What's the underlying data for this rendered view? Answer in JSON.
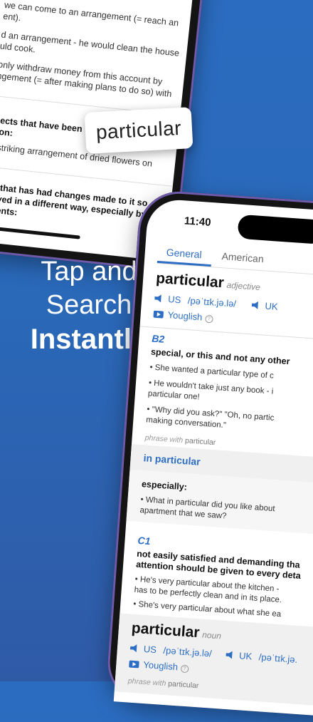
{
  "top_phone": {
    "lines": [
      "we can come to an arrangement (= reach an",
      "ent).",
      "d an arrangement - he would clean the house",
      "uld cook.",
      "only withdraw money from this account by",
      "ngement (= after making plans to do so) with",
      "bjects that have been",
      "ition:",
      "a striking arrangement of dried flowers on",
      "sic that has had changes made to it so",
      "played in a different way, especially by",
      "uments:"
    ]
  },
  "popup_word": "particular",
  "headline": {
    "line1": "Tap and",
    "line2": "Search",
    "line3": "Instantly"
  },
  "dictionary": {
    "time": "11:40",
    "tabs": [
      "General",
      "American"
    ],
    "entry1": {
      "headword": "particular",
      "pos": "adjective",
      "us_label": "US",
      "us_ipa": "/pəˈtɪk.jə.lə/",
      "uk_label": "UK",
      "youglish": "Youglish",
      "help": "?"
    },
    "sense1": {
      "level": "B2",
      "definition": "special, or this and not any other",
      "examples": [
        "• She wanted a particular type of c",
        "• He wouldn't take just any book - i",
        "particular one!",
        "• \"Why did you ask?\" \"Oh, no partic",
        "making conversation.\""
      ]
    },
    "phrase1": {
      "prefix": "phrase with",
      "word": "particular",
      "head": "in particular",
      "definition": "especially:",
      "examples": [
        "• What in particular did you like about",
        "apartment that we saw?"
      ]
    },
    "sense2": {
      "level": "C1",
      "definition_lines": [
        "not easily satisfied and demanding tha",
        "attention should be given to every deta"
      ],
      "examples": [
        "• He's very particular about the kitchen -",
        "has to be perfectly clean and in its place.",
        "• She's very particular about what she ea"
      ]
    },
    "entry2": {
      "headword": "particular",
      "pos": "noun",
      "us_label": "US",
      "us_ipa": "/pəˈtɪk.jə.lə/",
      "uk_label": "UK",
      "uk_ipa": "/pəˈtɪk.jə.",
      "youglish": "Youglish",
      "help": "?"
    },
    "phrase2": {
      "prefix": "phrase with",
      "word": "particular"
    }
  },
  "colors": {
    "accent": "#2d6ec4",
    "background": "#2b6cc0",
    "phone_frame": "#6e5aa8"
  }
}
